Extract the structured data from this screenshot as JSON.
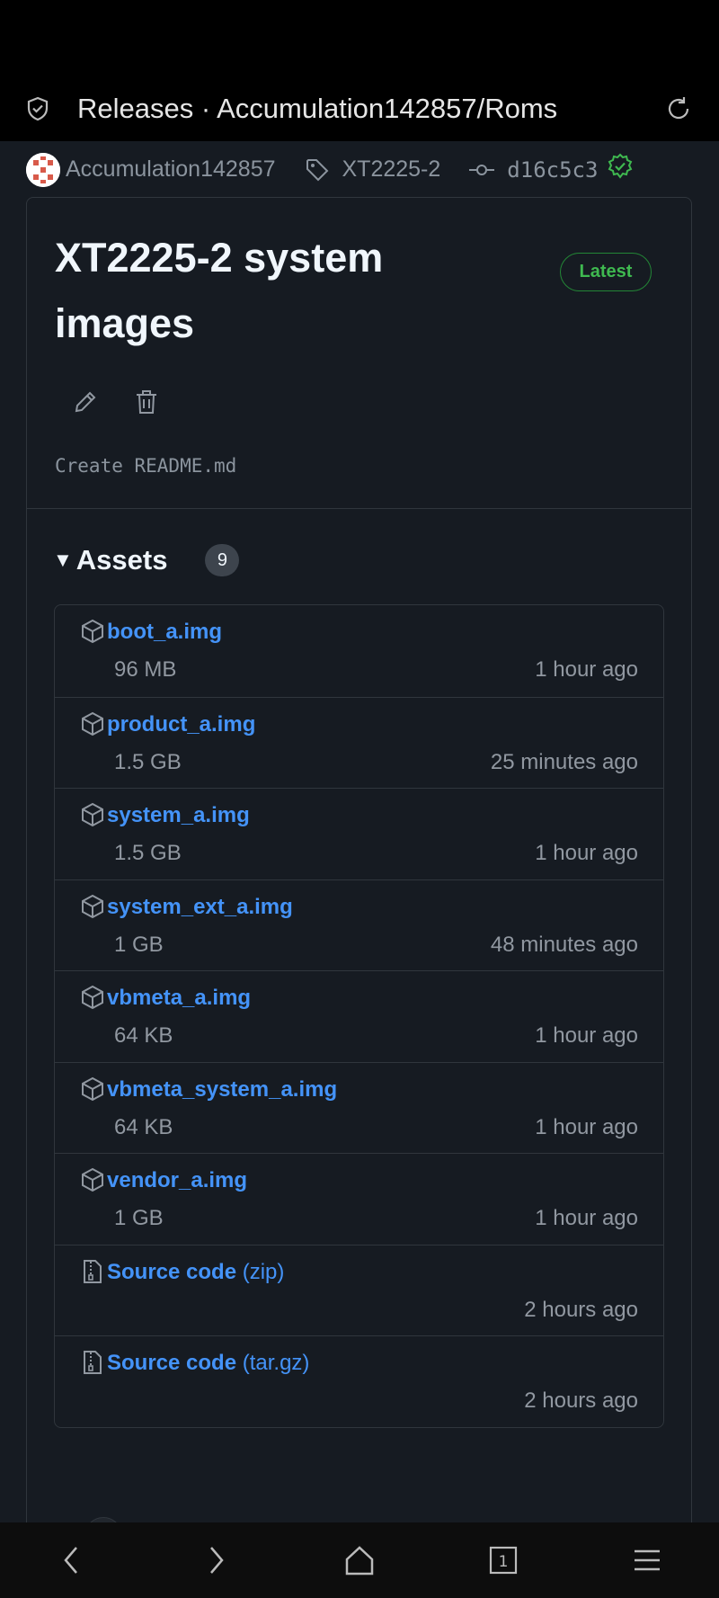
{
  "browser": {
    "title": "Releases · Accumulation142857/Roms",
    "shield_icon": "shield-check-icon",
    "reload_icon": "reload-icon"
  },
  "release": {
    "author": "Accumulation142857",
    "tag": "XT2225-2",
    "commit": "d16c5c3",
    "title": "XT2225-2 system images",
    "badge": "Latest",
    "commit_message": "Create README.md",
    "colors": {
      "link": "#4493f8",
      "badge_green": "#3fb950",
      "bg": "#161b22",
      "border": "#30363d"
    }
  },
  "assets": {
    "label": "Assets",
    "count": "9",
    "items": [
      {
        "name": "boot_a.img",
        "size": "96 MB",
        "time": "1 hour ago",
        "icon": "package-icon"
      },
      {
        "name": "product_a.img",
        "size": "1.5 GB",
        "time": "25 minutes ago",
        "icon": "package-icon"
      },
      {
        "name": "system_a.img",
        "size": "1.5 GB",
        "time": "1 hour ago",
        "icon": "package-icon"
      },
      {
        "name": "system_ext_a.img",
        "size": "1 GB",
        "time": "48 minutes ago",
        "icon": "package-icon"
      },
      {
        "name": "vbmeta_a.img",
        "size": "64 KB",
        "time": "1 hour ago",
        "icon": "package-icon"
      },
      {
        "name": "vbmeta_system_a.img",
        "size": "64 KB",
        "time": "1 hour ago",
        "icon": "package-icon"
      },
      {
        "name": "vendor_a.img",
        "size": "1 GB",
        "time": "1 hour ago",
        "icon": "package-icon"
      },
      {
        "name": "Source code",
        "ext": "(zip)",
        "size": "",
        "time": "2 hours ago",
        "icon": "file-zip-icon"
      },
      {
        "name": "Source code",
        "ext": "(tar.gz)",
        "size": "",
        "time": "2 hours ago",
        "icon": "file-zip-icon"
      }
    ]
  },
  "navbar": {
    "items": [
      "back-icon",
      "forward-icon",
      "home-icon",
      "tabs-icon",
      "menu-icon"
    ],
    "tab_count": "1"
  }
}
